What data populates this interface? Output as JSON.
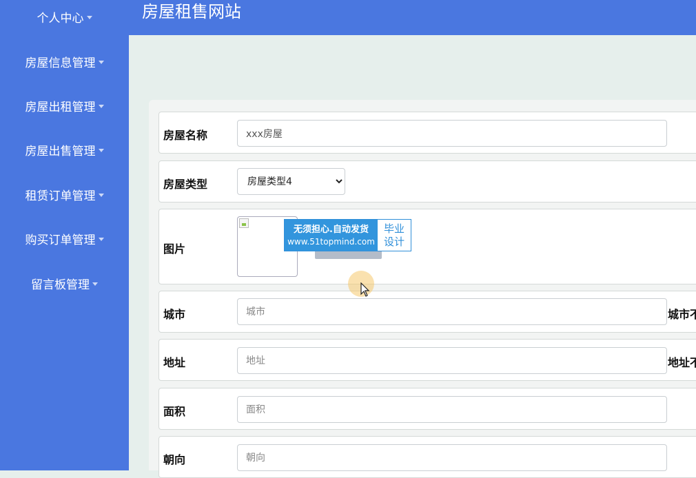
{
  "sidebar": {
    "items": [
      {
        "label": "个人中心"
      },
      {
        "label": "房屋信息管理"
      },
      {
        "label": "房屋出租管理"
      },
      {
        "label": "房屋出售管理"
      },
      {
        "label": "租赁订单管理"
      },
      {
        "label": "购买订单管理"
      },
      {
        "label": "留言板管理"
      }
    ]
  },
  "header": {
    "title": "房屋租售网站"
  },
  "form": {
    "house_name": {
      "label": "房屋名称",
      "value": "xxx房屋"
    },
    "house_type": {
      "label": "房屋类型",
      "selected": "房屋类型4"
    },
    "image": {
      "label": "图片"
    },
    "city": {
      "label": "城市",
      "placeholder": "城市",
      "hint": "城市不"
    },
    "address": {
      "label": "地址",
      "placeholder": "地址",
      "hint": "地址不"
    },
    "area": {
      "label": "面积",
      "placeholder": "面积"
    },
    "orientation": {
      "label": "朝向",
      "placeholder": "朝向"
    }
  },
  "watermark": {
    "line1": "无须担心.自动发货",
    "line2": "www.51topmind.com",
    "right1": "毕业",
    "right2": "设计"
  },
  "colors": {
    "primary": "#4a77e0",
    "background": "#e6efec",
    "watermark": "#3295dd"
  }
}
